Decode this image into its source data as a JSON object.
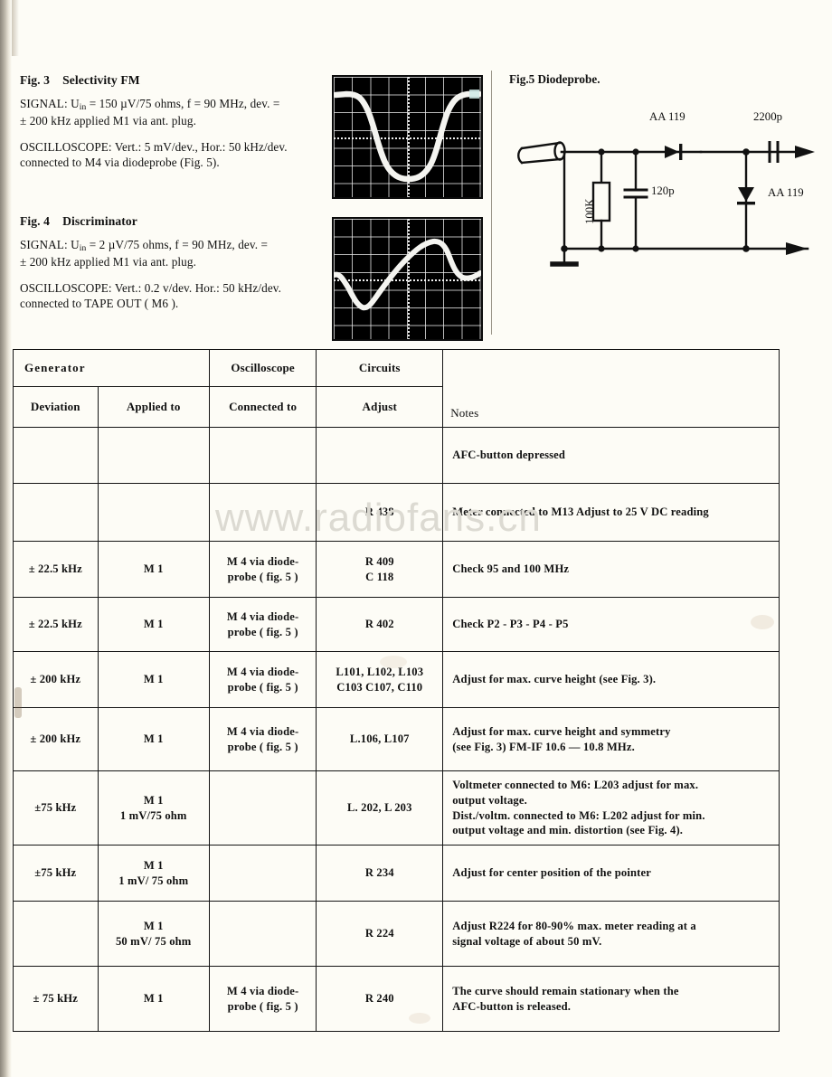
{
  "figures": {
    "fig3": {
      "title_num": "Fig. 3",
      "title_text": "Selectivity FM",
      "signal_line1_a": "SIGNAL: U",
      "signal_line1_sub": "in",
      "signal_line1_b": " = 150 µV/75 ohms, f = 90 MHz, dev. =",
      "signal_line2": "± 200 kHz applied M1 via ant. plug.",
      "scope_line1": "OSCILLOSCOPE: Vert.: 5 mV/dev., Hor.: 50 kHz/dev.",
      "scope_line2": "connected to M4 via diodeprobe (Fig. 5)."
    },
    "fig4": {
      "title_num": "Fig. 4",
      "title_text": "Discriminator",
      "signal_line1_a": "SIGNAL: U",
      "signal_line1_sub": "in",
      "signal_line1_b": " = 2 µV/75 ohms, f = 90 MHz, dev. =",
      "signal_line2": "± 200 kHz applied M1 via ant. plug.",
      "scope_line1": "OSCILLOSCOPE: Vert.: 0.2 v/dev. Hor.: 50 kHz/dev.",
      "scope_line2": "connected to  TAPE OUT ( M6 )."
    },
    "fig5": {
      "title": "Fig.5 Diodeprobe.",
      "resistor": "100K",
      "cap_input": "120p",
      "diode_series": "AA 119",
      "cap_output": "2200p",
      "diode_shunt": "AA 119"
    }
  },
  "watermark": "www.radiofans.cn",
  "table": {
    "group_headers": [
      {
        "label": "Generator",
        "colspan": 2
      },
      {
        "label": "Oscilloscope",
        "colspan": 1
      },
      {
        "label": "Circuits",
        "colspan": 1
      },
      {
        "label": "",
        "colspan": 1
      }
    ],
    "column_headers": [
      "Deviation",
      "Applied to",
      "Connected to",
      "Adjust",
      "Notes"
    ],
    "rows": [
      {
        "deviation": "",
        "applied_to": "",
        "connected_to": "",
        "adjust": "",
        "notes": "AFC-button depressed"
      },
      {
        "deviation": "",
        "applied_to": "",
        "connected_to": "",
        "adjust": "R 438",
        "notes": "Meter connected to M13  Adjust to 25 V DC reading"
      },
      {
        "deviation": "± 22.5 kHz",
        "applied_to": "M 1",
        "connected_to": "M 4 via diode-\nprobe ( fig. 5 )",
        "adjust": "R 409\nC 118",
        "notes": "Check 95 and 100 MHz"
      },
      {
        "deviation": "± 22.5  kHz",
        "applied_to": "M 1",
        "connected_to": "M 4 via diode-\nprobe ( fig. 5 )",
        "adjust": "R 402",
        "notes": "Check P2 - P3 - P4 - P5"
      },
      {
        "deviation": "± 200 kHz",
        "applied_to": "M 1",
        "connected_to": "M 4 via diode-\nprobe ( fig. 5 )",
        "adjust": "L101, L102, L103\nC103  C107, C110",
        "notes": "Adjust for max. curve height (see Fig. 3)."
      },
      {
        "deviation": "± 200  kHz",
        "applied_to": "M 1",
        "connected_to": "M 4 via diode-\nprobe ( fig. 5 )",
        "adjust": "L.106, L107",
        "notes": "Adjust for max. curve height and symmetry\n(see Fig. 3) FM-IF  10.6 — 10.8 MHz."
      },
      {
        "deviation": "±75   kHz",
        "applied_to": "M 1\n1 mV/75 ohm",
        "connected_to": "",
        "adjust": "L. 202, L 203",
        "notes": "Voltmeter connected to M6:  L203 adjust for max.\noutput voltage.\nDist./voltm. connected to M6:  L202 adjust for min.\noutput voltage and min. distortion (see Fig. 4)."
      },
      {
        "deviation": "±75   kHz",
        "applied_to": "M 1\n1 mV/ 75 ohm",
        "connected_to": "",
        "adjust": "R 234",
        "notes": "Adjust for center position of the pointer"
      },
      {
        "deviation": "",
        "applied_to": "M 1\n50 mV/ 75 ohm",
        "connected_to": "",
        "adjust": "R 224",
        "notes": "Adjust R224 for 80-90% max. meter reading at a\nsignal voltage of about 50 mV."
      },
      {
        "deviation": "± 75 kHz",
        "applied_to": "M 1",
        "connected_to": "M 4 via diode-\nprobe ( fig. 5 )",
        "adjust": "R 240",
        "notes": "The curve should remain stationary when the\nAFC-button is released."
      }
    ]
  },
  "chart_data": [
    {
      "type": "line",
      "title": "Fig. 3 Selectivity FM",
      "xlabel": "Hor.: 50 kHz/dev.",
      "ylabel": "Vert.: 5 mV/dev.",
      "annotation": "Inverted selectivity response curve (flat-bottom bowl) on 8x6 graticule",
      "x": [
        0,
        0.6,
        1.1,
        1.5,
        1.9,
        2.4,
        3.0,
        3.6,
        4.0,
        4.5,
        5.1,
        5.6,
        6.1,
        6.5,
        7.0,
        7.6,
        8.0
      ],
      "y": [
        5.6,
        5.6,
        5.4,
        4.6,
        3.4,
        2.0,
        1.0,
        0.55,
        0.45,
        0.45,
        0.6,
        1.3,
        2.6,
        3.9,
        5.0,
        5.6,
        5.6
      ],
      "xlim": [
        0,
        8
      ],
      "ylim": [
        0,
        6
      ],
      "grid": true
    },
    {
      "type": "line",
      "title": "Fig. 4 Discriminator",
      "xlabel": "Hor.: 50 kHz/dev.",
      "ylabel": "Vert.: 0.2 v/dev.",
      "annotation": "S-shaped discriminator characteristic crossing zero at centre",
      "x": [
        0,
        0.5,
        1.0,
        1.5,
        2.0,
        2.6,
        3.2,
        4.0,
        4.8,
        5.5,
        6.1,
        6.6,
        7.1,
        7.6,
        8.0
      ],
      "y": [
        3.4,
        3.1,
        2.4,
        1.7,
        1.4,
        1.8,
        2.4,
        3.0,
        3.7,
        4.4,
        4.7,
        4.5,
        3.9,
        3.3,
        3.1
      ],
      "xlim": [
        0,
        8
      ],
      "ylim": [
        0,
        6
      ],
      "grid": true
    }
  ]
}
